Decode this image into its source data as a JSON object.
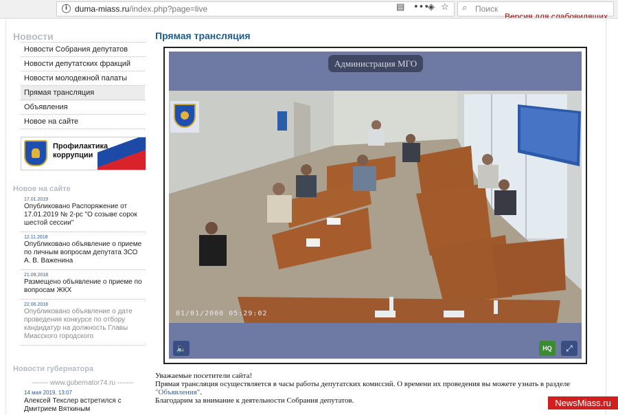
{
  "browser": {
    "url_host": "duma-miass.ru",
    "url_path": "/index.php?page=live",
    "search_placeholder": "Поиск"
  },
  "top_link": "Версия для слабовидящих",
  "sidebar": {
    "news_heading": "Новости",
    "menu": [
      {
        "label": "Новости Собрания депутатов"
      },
      {
        "label": "Новости депутатских фракций"
      },
      {
        "label": "Новости молодежной палаты"
      },
      {
        "label": "Прямая трансляция"
      },
      {
        "label": "Объявления"
      },
      {
        "label": "Новое на сайте"
      }
    ],
    "banner_text": "Профилактика коррупции",
    "new_heading": "Новое на сайте",
    "new_items": [
      {
        "date": "17.01.2019",
        "text": "Опубликовано Распоряжение от 17.01.2019 № 2-рс \"О созыве сорок шестой сессии\""
      },
      {
        "date": "12.11.2018",
        "text": "Опубликовано объявление о приеме по личным вопросам депутата ЗСО А. В. Важенина"
      },
      {
        "date": "21.09.2018",
        "text": "Размещено объявление о приеме по вопросам ЖКХ"
      },
      {
        "date": "22.06.2018",
        "text": "Опубликовано объявление о дате проведения конкурсе по отбору кандидатур на должность Главы Миасского городского"
      }
    ],
    "gov_heading": "Новости губернатора",
    "gov_source": "------- www.gubernator74.ru -------",
    "gov_date": "14 мая 2019, 13:07",
    "gov_text": "Алексей Текслер встретился с Дмитрием Вяткиным"
  },
  "main": {
    "title": "Прямая трансляция",
    "camera_label": "Администрация МГО",
    "timestamp": "01/01/2000 05:29:02",
    "hq_label": "HQ",
    "notice_greeting": "Уважаемые посетители сайта!",
    "notice_line1": "Прямая трансляция осуществляется в часы работы депутатских комиссий. О времени их проведения вы можете узнать в разделе ",
    "notice_link": "\"Объявления\"",
    "notice_link_after": ".",
    "notice_line2": "Благодарим за внимание к деятельности Собрания депутатов."
  },
  "watermark": "NewsMiass.ru"
}
